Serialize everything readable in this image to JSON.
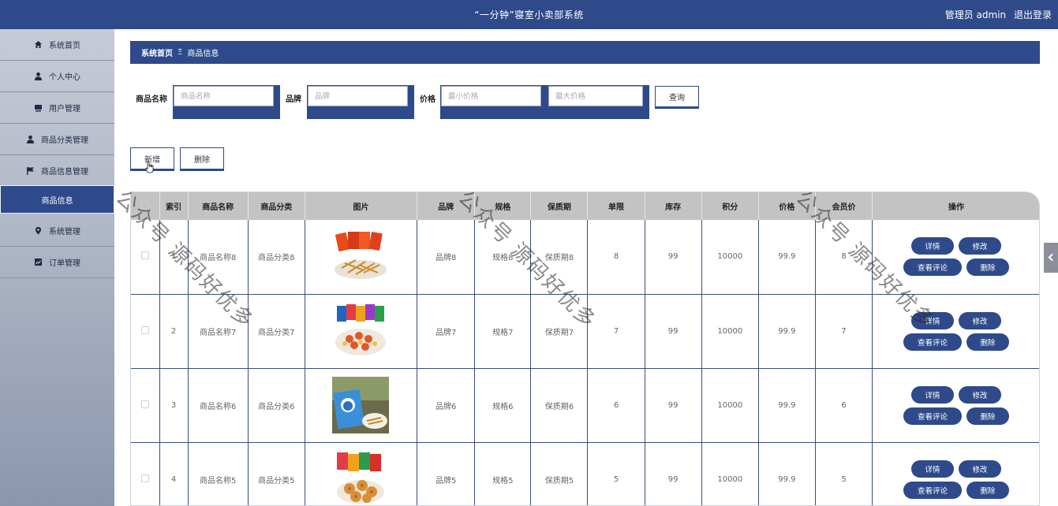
{
  "header": {
    "title": "“一分钟”寝室小卖部系统",
    "user": "管理员 admin",
    "logout": "退出登录"
  },
  "sidebar": {
    "items": [
      {
        "label": "系统首页",
        "icon": "home-icon"
      },
      {
        "label": "个人中心",
        "icon": "user-icon"
      },
      {
        "label": "用户管理",
        "icon": "monitor-icon"
      },
      {
        "label": "商品分类管理",
        "icon": "user-icon"
      },
      {
        "label": "商品信息管理",
        "icon": "flag-icon"
      },
      {
        "label": "商品信息",
        "icon": ""
      },
      {
        "label": "系统管理",
        "icon": "pin-icon"
      },
      {
        "label": "订单管理",
        "icon": "chart-icon"
      }
    ]
  },
  "breadcrumb": {
    "home": "系统首页",
    "sep": "Ξ",
    "current": "商品信息"
  },
  "search": {
    "name_label": "商品名称",
    "name_placeholder": "商品名称",
    "brand_label": "品牌",
    "brand_placeholder": "品牌",
    "price_label": "价格",
    "price_min_placeholder": "最小价格",
    "price_max_placeholder": "最大价格",
    "query_button": "查询"
  },
  "actions": {
    "add": "新增",
    "delete": "删除"
  },
  "table": {
    "headers": [
      "",
      "索引",
      "商品名称",
      "商品分类",
      "图片",
      "品牌",
      "规格",
      "保质期",
      "单限",
      "库存",
      "积分",
      "价格",
      "会员价",
      "操作"
    ],
    "rows": [
      {
        "index": "1",
        "name": "商品名称8",
        "category": "商品分类8",
        "brand": "品牌8",
        "spec": "规格8",
        "shelf": "保质期8",
        "limit": "8",
        "stock": "99",
        "points": "10000",
        "price": "99.9",
        "member_price": "8"
      },
      {
        "index": "2",
        "name": "商品名称7",
        "category": "商品分类7",
        "brand": "品牌7",
        "spec": "规格7",
        "shelf": "保质期7",
        "limit": "7",
        "stock": "99",
        "points": "10000",
        "price": "99.9",
        "member_price": "7"
      },
      {
        "index": "3",
        "name": "商品名称6",
        "category": "商品分类6",
        "brand": "品牌6",
        "spec": "规格6",
        "shelf": "保质期6",
        "limit": "6",
        "stock": "99",
        "points": "10000",
        "price": "99.9",
        "member_price": "6"
      },
      {
        "index": "4",
        "name": "商品名称5",
        "category": "商品分类5",
        "brand": "品牌5",
        "spec": "规格5",
        "shelf": "保质期5",
        "limit": "5",
        "stock": "99",
        "points": "10000",
        "price": "99.9",
        "member_price": "5"
      }
    ],
    "op_labels": {
      "detail": "详情",
      "edit": "修改",
      "comments": "查看评论",
      "delete": "删除"
    }
  },
  "watermark": "公众号 源码好优多",
  "colors": {
    "primary": "#2e4a8a",
    "header_gray": "#c3c3c3"
  }
}
